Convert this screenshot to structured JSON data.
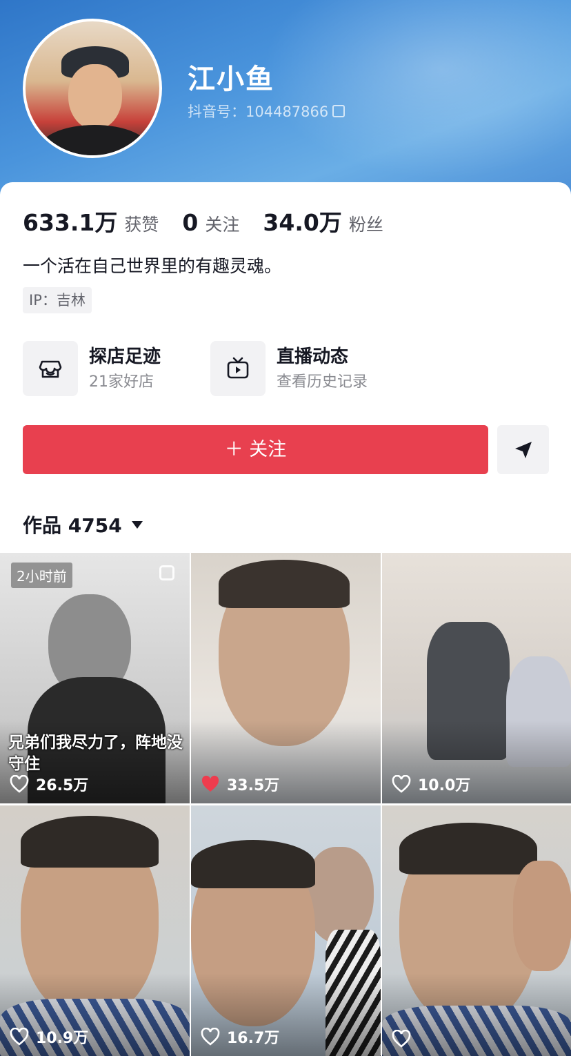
{
  "profile": {
    "name": "江小鱼",
    "douyin_id": "抖音号：104487866",
    "bio": "一个活在自己世界里的有趣灵魂。",
    "ip": "IP：吉林"
  },
  "stats": [
    {
      "value": "633.1万",
      "label": "获赞"
    },
    {
      "value": "0",
      "label": "关注"
    },
    {
      "value": "34.0万",
      "label": "粉丝"
    }
  ],
  "features": [
    {
      "title": "探店足迹",
      "subtitle": "21家好店",
      "icon": "store-icon"
    },
    {
      "title": "直播动态",
      "subtitle": "查看历史记录",
      "icon": "tv-play-icon"
    }
  ],
  "actions": {
    "follow_label": "＋ 关注",
    "share_icon": "send-icon"
  },
  "works": {
    "label": "作品 4754"
  },
  "videos": [
    {
      "likes": "26.5万",
      "liked": false,
      "badge": "2小时前",
      "caption": "兄弟们我尽力了，阵地没守住",
      "pinned_icon": "select-icon"
    },
    {
      "likes": "33.5万",
      "liked": true
    },
    {
      "likes": "10.0万",
      "liked": false
    },
    {
      "likes": "10.9万",
      "liked": false
    },
    {
      "likes": "16.7万",
      "liked": false
    },
    {
      "likes": "",
      "liked": false
    }
  ],
  "colors": {
    "accent": "#e8404f",
    "header": "#3b84d2",
    "text": "#161823",
    "secondary": "#62636b"
  }
}
